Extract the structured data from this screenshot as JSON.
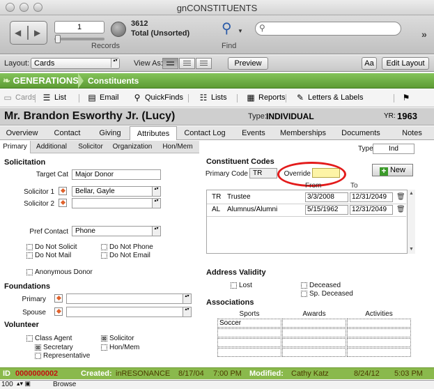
{
  "window": {
    "title": "gnCONSTITUENTS"
  },
  "toolbar": {
    "record_number": "1",
    "record_count": "3612",
    "found_status": "Total (Unsorted)",
    "records_label": "Records",
    "find_label": "Find",
    "search_placeholder": ""
  },
  "layout_bar": {
    "layout_label": "Layout:",
    "layout_value": "Cards",
    "view_as_label": "View As:",
    "preview_label": "Preview",
    "font_button": "Aa",
    "edit_layout_label": "Edit Layout"
  },
  "nav": {
    "logo": "GENERATIONS",
    "breadcrumb": "Constituents"
  },
  "modules": [
    {
      "label": "Cards",
      "icon": "cards-icon",
      "glyph": "▭",
      "enabled": false
    },
    {
      "label": "List",
      "icon": "list-icon",
      "glyph": "☰",
      "enabled": true
    },
    {
      "label": "Email",
      "icon": "email-icon",
      "glyph": "▤",
      "enabled": true
    },
    {
      "label": "QuickFinds",
      "icon": "magnifier-icon",
      "glyph": "⚲",
      "enabled": true
    },
    {
      "label": "Lists",
      "icon": "lists-icon",
      "glyph": "☷",
      "enabled": true
    },
    {
      "label": "Reports",
      "icon": "reports-icon",
      "glyph": "▦",
      "enabled": true
    },
    {
      "label": "Letters & Labels",
      "icon": "pencil-icon",
      "glyph": "✎",
      "enabled": true
    },
    {
      "label": "",
      "icon": "gift-icon",
      "glyph": "⚑",
      "enabled": true
    }
  ],
  "constituent": {
    "name": "Mr. Brandon Esworthy Jr. (Lucy)",
    "type_label": "Type:",
    "type_value": "INDIVIDUAL",
    "yr_label": "YR:",
    "yr_value": "1963"
  },
  "tabs": [
    "Overview",
    "Contact",
    "Giving",
    "Attributes",
    "Contact Log",
    "Events",
    "Memberships",
    "Documents",
    "Notes"
  ],
  "active_tab": "Attributes",
  "subtabs": [
    "Primary",
    "Additional",
    "Solicitor",
    "Organization",
    "Hon/Mem"
  ],
  "type_field": {
    "label": "Type",
    "value": "Ind"
  },
  "solicitation": {
    "title": "Solicitation",
    "target_cat_label": "Target Cat",
    "target_cat_value": "Major Donor",
    "solicitor1_label": "Solicitor 1",
    "solicitor1_value": "Bellar, Gayle",
    "solicitor2_label": "Solicitor 2",
    "solicitor2_value": "",
    "pref_contact_label": "Pref Contact",
    "pref_contact_value": "Phone",
    "checks": {
      "do_not_solicit": "Do Not Solicit",
      "do_not_phone": "Do Not Phone",
      "do_not_mail": "Do Not Mail",
      "do_not_email": "Do Not Email",
      "anonymous": "Anonymous Donor"
    }
  },
  "foundations": {
    "title": "Foundations",
    "primary_label": "Primary",
    "primary_value": "",
    "spouse_label": "Spouse",
    "spouse_value": ""
  },
  "volunteer": {
    "title": "Volunteer",
    "class_agent": "Class Agent",
    "solicitor": "Solicitor",
    "secretary": "Secretary",
    "hon_mem": "Hon/Mem",
    "representative": "Representative",
    "solicitor_mark": "⊠",
    "secretary_mark": "⊠"
  },
  "codes": {
    "title": "Constituent Codes",
    "primary_code_label": "Primary Code",
    "primary_code_value": "TR",
    "override_label": "Override",
    "override_value": "",
    "new_label": "New",
    "from_label": "From",
    "to_label": "To",
    "rows": [
      {
        "code": "TR",
        "desc": "Trustee",
        "from": "3/3/2008",
        "to": "12/31/2049"
      },
      {
        "code": "AL",
        "desc": "Alumnus/Alumni",
        "from": "5/15/1962",
        "to": "12/31/2049"
      }
    ]
  },
  "address_validity": {
    "title": "Address Validity",
    "lost": "Lost",
    "deceased": "Deceased",
    "sp_deceased": "Sp. Deceased"
  },
  "associations": {
    "title": "Associations",
    "headers": [
      "Sports",
      "Awards",
      "Activities"
    ],
    "sports": [
      "Soccer",
      "",
      "",
      ""
    ]
  },
  "footer": {
    "id_label": "ID",
    "id_value": "0000000002",
    "created_label": "Created:",
    "created_by": "inRESONANCE",
    "created_date": "8/17/04",
    "created_time": "7:00 PM",
    "modified_label": "Modified:",
    "modified_by": "Cathy Katz",
    "modified_date": "8/24/12",
    "modified_time": "5:03 PM"
  },
  "statusbar": {
    "zoom": "100",
    "mode": "Browse"
  }
}
